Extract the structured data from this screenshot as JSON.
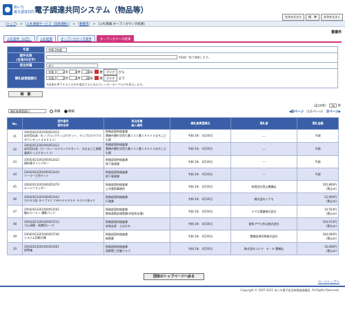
{
  "header": {
    "logo_line1": "あいち",
    "logo_line2": "電子調達共同",
    "title": "電子調達共同システム（物品等）",
    "buttons": [
      "文字の大きさ",
      "標　準",
      "文字を大きく"
    ]
  },
  "breadcrumb": {
    "items": [
      "トップ",
      "入札情報サービス（団体選択）",
      "豊橋市",
      "入札情報:オープンカウンタ結果"
    ],
    "sep": " > "
  },
  "city": "豊橋市",
  "tabs": [
    "入札案件（公告）",
    "入札結果",
    "オープンカウンタ案件",
    "オープンカウンタ結果"
  ],
  "search": {
    "nendo_label": "年度",
    "nendo_value": "令和 2年度",
    "name_label": "案件名称",
    "name_sub": "(全角50文字)",
    "name_note": "※前段一致で検索します。",
    "kind_label": "発注所属",
    "kind_value": "全て",
    "date_label": "開札結果登録日",
    "era": "令和",
    "from_y": "2",
    "from_m": "4",
    "from_d": "20",
    "to_y": "2",
    "to_m": "4",
    "to_d": "30",
    "u_year": "年",
    "u_month": "月",
    "u_day": "日",
    "cal_label": "暦",
    "clear_label": "クリア",
    "from_suffix": "から",
    "to_suffix": "まで",
    "date_note": "※画像を押下すると日付を指定するためのカレンダーダイアログを表示します。",
    "submit": "検　索"
  },
  "controls": {
    "sort_value": "開札結果登録日",
    "asc": "昇順",
    "desc": "降順"
  },
  "pager": {
    "count": "（全10件）",
    "per_page": "10",
    "per_unit": "件",
    "prev": "◀前ページ",
    "page_info": "（1/1ページ）",
    "next": "次ページ▶"
  },
  "table": {
    "headers": {
      "no": "No.",
      "case_no": "案件番号",
      "case_name": "案件名称",
      "dept": "発注所属",
      "place": "納入場所",
      "date": "開札結果登録日",
      "winner": "落札者",
      "amount": "落札金額"
    },
    "rows": [
      {
        "no": "41",
        "case_no": "20042023201000452411",
        "case_name": "幼児用玩具（モノブロックたっぷりセット、デュプロカラフルタウンセット４５０２１）",
        "dept": "財務部契約検査課",
        "place": "豊橋市豊町字西七番１０１番１８０ミラまちこども館",
        "date": "令和 2年　4月30日",
        "winner": "---",
        "amount": "不調"
      },
      {
        "no": "42",
        "case_no": "20042023201000452412",
        "case_name": "幼児用玩具（カーゴレールデラックスセット、おままごと調理器具たっぷりセット２）",
        "dept": "財務部契約検査課",
        "place": "豊橋市豊町字西七番１０１番１８０ミラまちこども館",
        "date": "令和 2年　4月30日",
        "winner": "---",
        "amount": "不調"
      },
      {
        "no": "43",
        "case_no": "20042023201000452422",
        "case_name": "標料電子ミニパネー",
        "dept": "財務部契約検査課",
        "place": "地下資源課",
        "date": "令和 2年　4月30日",
        "winner": "---",
        "amount": "不調"
      },
      {
        "no": "44",
        "case_no": "20042023201000452424",
        "case_name": "ソーラー工作キット",
        "dept": "財務部契約検査課",
        "place": "地下資源課",
        "date": "令和 2年　4月30日",
        "winner": "---",
        "amount": "不調"
      },
      {
        "no": "45",
        "case_no": "20042023201000452470",
        "case_name": "エンジンカッター",
        "dept": "財務部契約検査課",
        "place": "土木建設事務所",
        "date": "令和 2年　4月30日",
        "winner": "有限会社西山農機店",
        "amount": "195,800円",
        "tax": "(税込み)"
      },
      {
        "no": "46",
        "case_no": "20042023201000452443",
        "case_name": "ホチキス針 タイプ３Ｃ ＣＷＡＡ０８５６ ５０００針×２",
        "dept": "財務部契約検査課",
        "place": "行政課",
        "date": "令和 2年　4月30日",
        "winner": "株式会社イクモ",
        "amount": "22,900円",
        "tax": "(税込み)"
      },
      {
        "no": "47",
        "case_no": "20042023201000452502",
        "case_name": "棚のカーテン 撮影パック",
        "dept": "財務部契約検査課",
        "place": "教育政策部政策課(市役所広場)",
        "date": "令和 2年　4月30日",
        "winner": "テクロ電器株式会社",
        "amount": "10,554円",
        "tax": "(税込み)"
      },
      {
        "no": "48",
        "case_no": "20042023201000452512",
        "case_name": "ゴム長靴・長携用シーズ",
        "dept": "財務部契約検査課",
        "place": "安城支部　とはだの",
        "date": "令和 2年　4月30日",
        "winner": "愛知アサヒ防災株式会社",
        "amount": "104,913円",
        "tax": "(税込み)"
      },
      {
        "no": "49",
        "case_no": "20042023201000452740",
        "case_name": "システム用紙付属",
        "dept": "財務部契約検査課",
        "place": "納税課",
        "date": "令和 2年　4月30日",
        "winner": "豊橋金商印刷株式会社",
        "amount": "184,000円",
        "tax": "(税込み)"
      },
      {
        "no": "50",
        "case_no": "20042023201000452461",
        "case_name": "保等箱",
        "dept": "財務部契約検査課",
        "place": "高師第三児童クラブ",
        "date": "令和 2年　4月30日",
        "winner": "株式会社コジマ　Ｋ・Ｒ 豊橋店",
        "amount": "10,000円",
        "tax": "(税込み)"
      }
    ]
  },
  "bottom_button": "団体のトップページへ戻る",
  "page_top": "ページトップへ",
  "footer": "Copyright © 2007-2021 あいち電子自治体推進協議会. All Rights Reserved."
}
